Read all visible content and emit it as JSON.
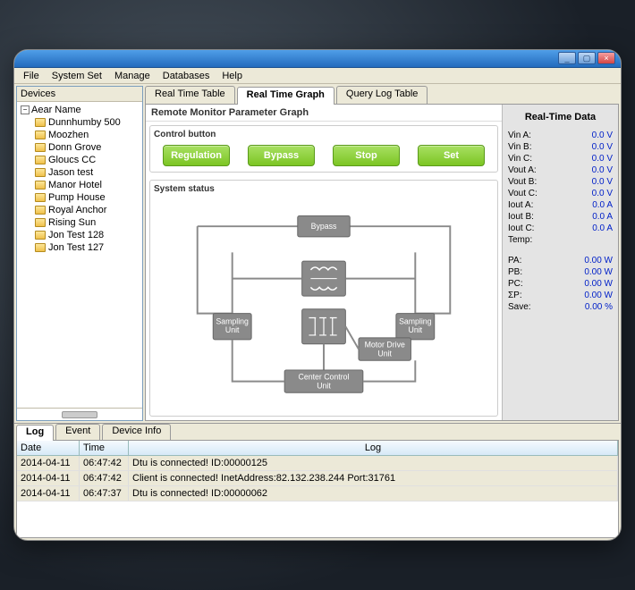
{
  "menubar": {
    "file": "File",
    "system_set": "System Set",
    "manage": "Manage",
    "databases": "Databases",
    "help": "Help"
  },
  "sidebar": {
    "title": "Devices",
    "root": "Aear Name",
    "items": [
      "Dunnhumby 500",
      "Moozhen",
      "Donn Grove",
      "Gloucs CC",
      "Jason test",
      "Manor Hotel",
      "Pump House",
      "Royal Anchor",
      "Rising Sun",
      "Jon Test 128",
      "Jon Test 127"
    ]
  },
  "tabs": {
    "t0": "Real Time Table",
    "t1": "Real Time Graph",
    "t2": "Query Log Table"
  },
  "panel": {
    "title": "Remote Monitor Parameter Graph",
    "control_label": "Control button",
    "buttons": {
      "regulation": "Regulation",
      "bypass": "Bypass",
      "stop": "Stop",
      "set": "Set"
    },
    "status_label": "System status",
    "diagram": {
      "bypass": "Bypass",
      "sampling_l": "Sampling\nUnit",
      "sampling_r": "Sampling\nUnit",
      "motor": "Motor Drive\nUnit",
      "center": "Center Control\nUnit"
    }
  },
  "rtdata": {
    "title": "Real-Time Data",
    "rows1": [
      {
        "k": "Vin A:",
        "v": "0.0 V"
      },
      {
        "k": "Vin B:",
        "v": "0.0 V"
      },
      {
        "k": "Vin C:",
        "v": "0.0 V"
      },
      {
        "k": "Vout A:",
        "v": "0.0 V"
      },
      {
        "k": "Vout B:",
        "v": "0.0 V"
      },
      {
        "k": "Vout C:",
        "v": "0.0 V"
      },
      {
        "k": "Iout A:",
        "v": "0.0 A"
      },
      {
        "k": "Iout B:",
        "v": "0.0 A"
      },
      {
        "k": "Iout C:",
        "v": "0.0 A"
      },
      {
        "k": "Temp:",
        "v": ""
      }
    ],
    "rows2": [
      {
        "k": "PA:",
        "v": "0.00 W"
      },
      {
        "k": "PB:",
        "v": "0.00 W"
      },
      {
        "k": "PC:",
        "v": "0.00 W"
      },
      {
        "k": "ΣP:",
        "v": "0.00 W"
      },
      {
        "k": "Save:",
        "v": "0.00 %"
      }
    ]
  },
  "bottom_tabs": {
    "log": "Log",
    "event": "Event",
    "device_info": "Device Info"
  },
  "log": {
    "headers": {
      "date": "Date",
      "time": "Time",
      "log": "Log"
    },
    "rows": [
      {
        "date": "2014-04-11",
        "time": "06:47:42",
        "log": "Dtu is connected!   ID:00000125"
      },
      {
        "date": "2014-04-11",
        "time": "06:47:42",
        "log": "Client is connected!   InetAddress:82.132.238.244  Port:31761"
      },
      {
        "date": "2014-04-11",
        "time": "06:47:37",
        "log": "Dtu is connected!   ID:00000062"
      }
    ]
  }
}
